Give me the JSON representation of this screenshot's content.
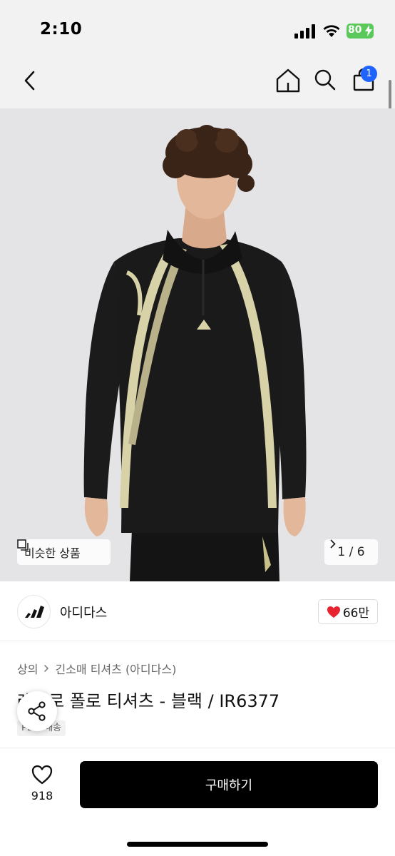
{
  "status_bar": {
    "time": "2:10",
    "battery_level": "80",
    "battery_color": "#5ac85a"
  },
  "nav": {
    "icons": [
      "back-icon",
      "home-icon",
      "search-icon",
      "cart-icon"
    ],
    "cart_badge": "1",
    "badge_color": "#1f64ff"
  },
  "gallery": {
    "similar_label": "비슷한 상품",
    "counter": "1 / 6"
  },
  "brand": {
    "name": "아디다스",
    "likes": "66만",
    "heart_color": "#e8222e"
  },
  "product": {
    "breadcrumb": [
      "상의",
      "긴소매 티셔츠 (아디다스)"
    ],
    "title": "레트로 폴로 티셔츠 - 블랙 / IR6377",
    "delivery_tag": "PLUS배송"
  },
  "bottom_bar": {
    "wish_count": "918",
    "buy_label": "구매하기"
  }
}
